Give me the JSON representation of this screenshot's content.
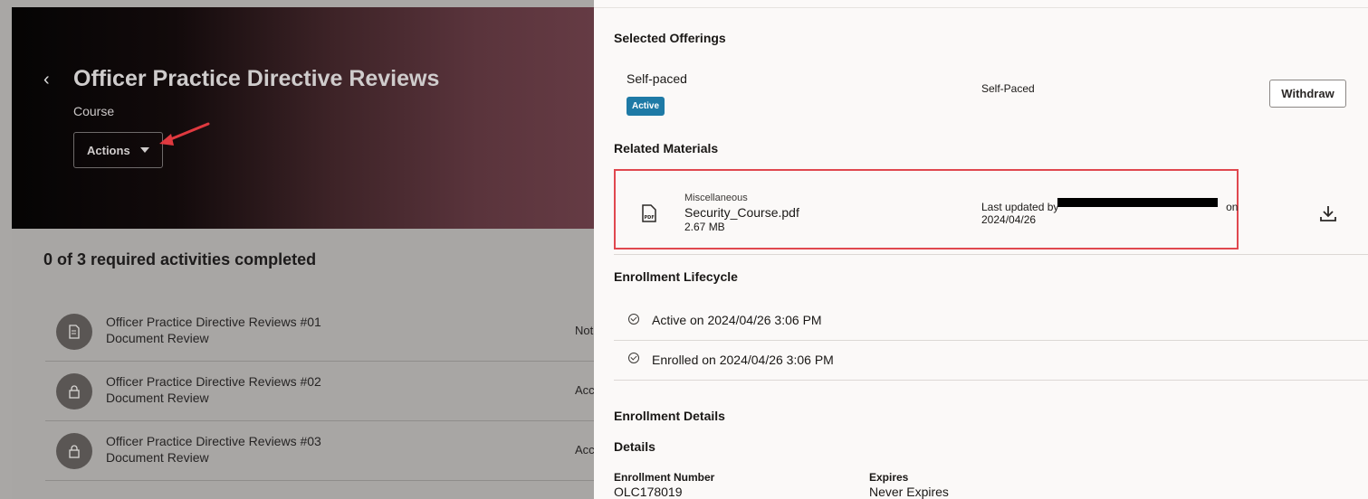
{
  "course": {
    "back_glyph": "‹",
    "title": "Officer Practice Directive Reviews",
    "type": "Course",
    "actions_label": "Actions"
  },
  "progress_text": "0 of 3 required activities completed",
  "activities": [
    {
      "title": "Officer Practice Directive Reviews #01",
      "subtitle": "Document Review",
      "status": "Not",
      "icon": "document-icon"
    },
    {
      "title": "Officer Practice Directive Reviews #02",
      "subtitle": "Document Review",
      "status": "Acc",
      "icon": "lock-icon"
    },
    {
      "title": "Officer Practice Directive Reviews #03",
      "subtitle": "Document Review",
      "status": "Acc",
      "icon": "lock-icon"
    }
  ],
  "drawer": {
    "selected_offerings": {
      "heading": "Selected Offerings",
      "name": "Self-paced",
      "badge": "Active",
      "delivery": "Self-Paced",
      "withdraw_label": "Withdraw"
    },
    "related_materials": {
      "heading": "Related Materials",
      "category": "Miscellaneous",
      "file_name": "Security_Course.pdf",
      "file_size": "2.67 MB",
      "updated_prefix": "Last updated by",
      "updated_suffix": "on",
      "updated_date": "2024/04/26"
    },
    "lifecycle": {
      "heading": "Enrollment Lifecycle",
      "events": [
        "Active on 2024/04/26 3:06 PM",
        "Enrolled on 2024/04/26 3:06 PM"
      ]
    },
    "details": {
      "heading": "Enrollment Details",
      "subheading": "Details",
      "enrollment_number_label": "Enrollment Number",
      "enrollment_number": "OLC178019",
      "expires_label": "Expires",
      "expires_value": "Never Expires"
    }
  },
  "colors": {
    "badge": "#1e7aa6",
    "highlight_box": "#e0484f",
    "annotation_arrow": "#e0393f"
  }
}
